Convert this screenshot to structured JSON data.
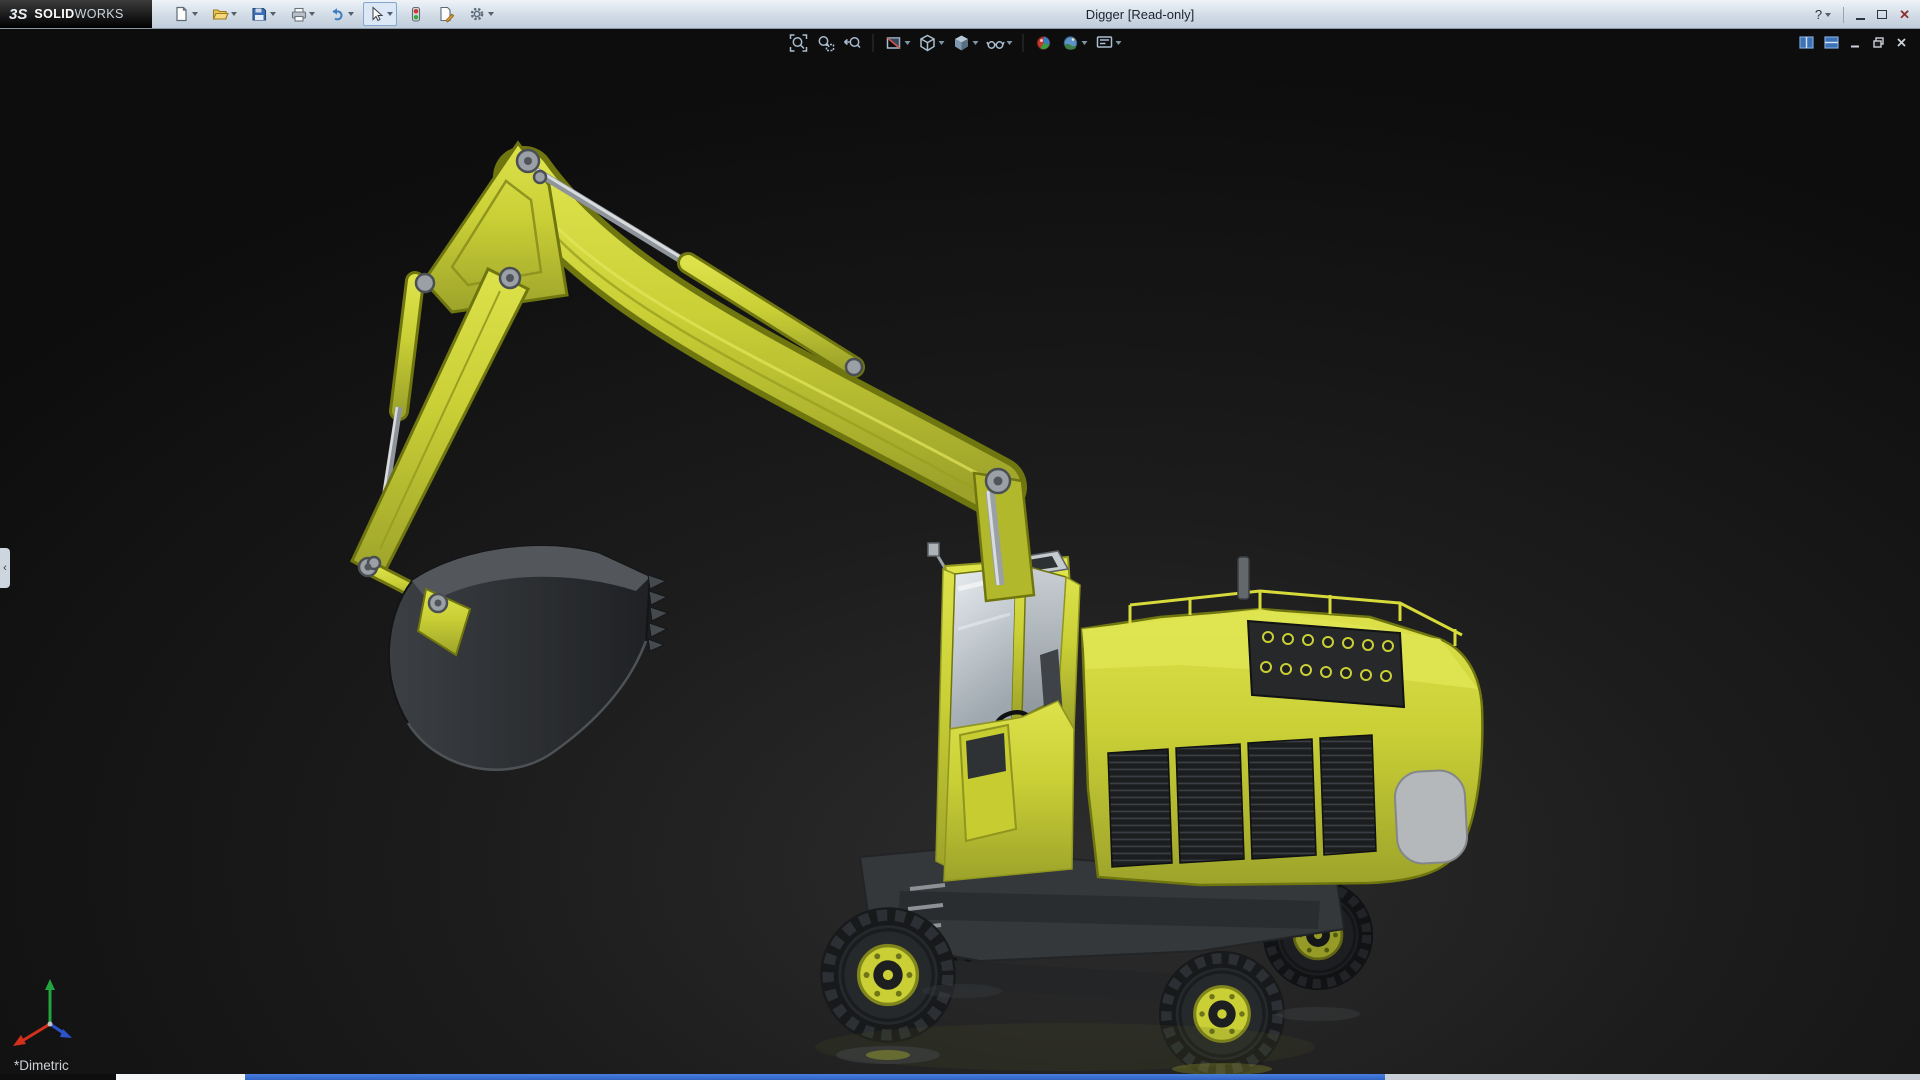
{
  "window": {
    "brand": {
      "logo_mark": "3S",
      "name_primary": "SOLID",
      "name_secondary": "WORKS"
    },
    "title": "Digger [Read-only]",
    "help_glyph": "?",
    "close_glyph": "✕",
    "window_controls": [
      "help",
      "minimize",
      "maximize",
      "close"
    ]
  },
  "main_toolbar": {
    "tools": [
      {
        "name": "new-document",
        "dropdown": true
      },
      {
        "name": "open",
        "dropdown": true
      },
      {
        "name": "save",
        "dropdown": true
      },
      {
        "name": "print",
        "dropdown": true
      },
      {
        "name": "undo",
        "dropdown": true
      },
      {
        "name": "select",
        "dropdown": true,
        "active": true
      },
      {
        "name": "rebuild",
        "dropdown": false
      },
      {
        "name": "file-properties",
        "dropdown": false
      },
      {
        "name": "options",
        "dropdown": true
      }
    ]
  },
  "heads_up_toolbar": {
    "tools": [
      {
        "name": "zoom-to-fit",
        "dropdown": false
      },
      {
        "name": "zoom-to-area",
        "dropdown": false
      },
      {
        "name": "previous-view",
        "dropdown": false
      },
      {
        "name": "section-view",
        "dropdown": true
      },
      {
        "name": "view-orientation",
        "dropdown": true
      },
      {
        "name": "display-style",
        "dropdown": true
      },
      {
        "name": "hide-show-items",
        "dropdown": true
      },
      {
        "name": "edit-appearance",
        "dropdown": false
      },
      {
        "name": "apply-scene",
        "dropdown": true
      },
      {
        "name": "view-settings",
        "dropdown": true
      }
    ]
  },
  "document_window": {
    "buttons": [
      "tile-pane",
      "split-pane",
      "minimize",
      "restore",
      "close"
    ]
  },
  "viewport": {
    "view_orientation_label": "*Dimetric",
    "model_name": "Digger",
    "panel_tab_glyph": "‹",
    "triad_axes": [
      "x-red",
      "y-green",
      "z-blue"
    ]
  },
  "colors": {
    "machine_yellow": "#c9cf35",
    "machine_yellow_dark": "#70760f",
    "glass": "#cfd5d9",
    "tire": "#26292c",
    "hud_icon": "#a9bdd0",
    "taskbar_blue": "#2f63c4"
  }
}
